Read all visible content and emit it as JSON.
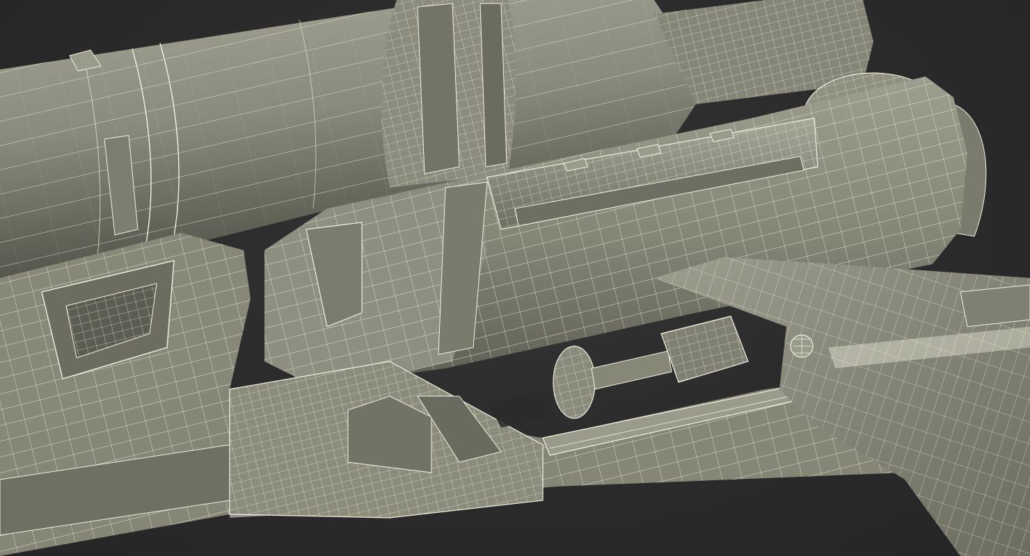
{
  "scene": {
    "kind": "3d-wireframe-render",
    "subject": "weapon-model",
    "display_mode": "shaded-with-wireframe",
    "colors": {
      "background": "#2b2b2b",
      "surface": "#8d8e7f",
      "surface_dark": "#5c5d52",
      "surface_light": "#a3a494",
      "wire": "#f4f3e4"
    }
  }
}
